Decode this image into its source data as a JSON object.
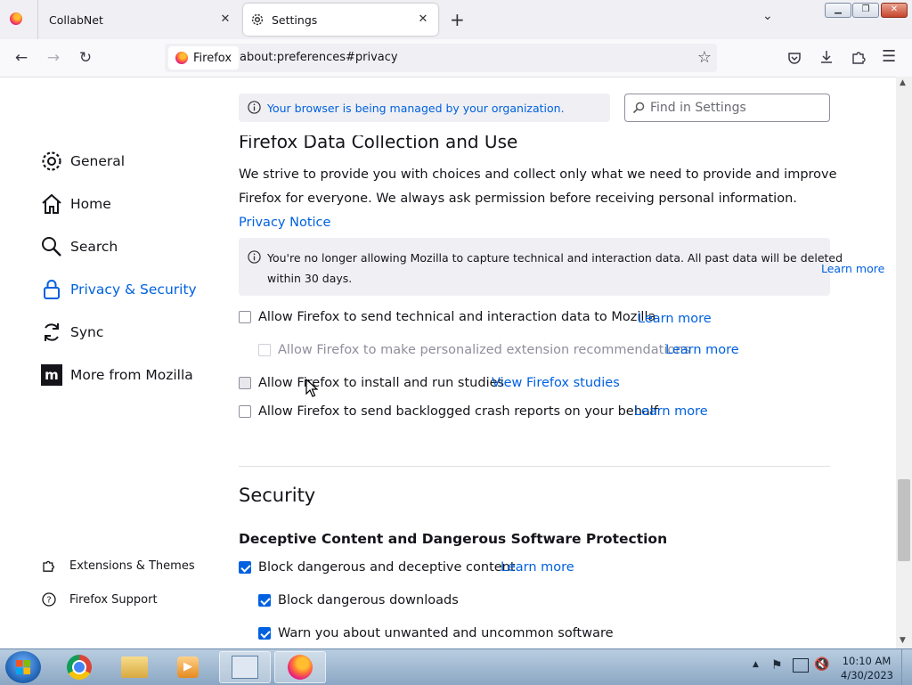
{
  "browser": {
    "tabs": [
      {
        "title": "CollabNet"
      },
      {
        "title": "Settings"
      }
    ],
    "identity_label": "Firefox",
    "url": "about:preferences#privacy"
  },
  "managed_notice": "Your browser is being managed by your organization.",
  "search": {
    "placeholder": "Find in Settings"
  },
  "sidebar": {
    "items": [
      {
        "label": "General",
        "icon": "gear-icon"
      },
      {
        "label": "Home",
        "icon": "home-icon"
      },
      {
        "label": "Search",
        "icon": "search-icon"
      },
      {
        "label": "Privacy & Security",
        "icon": "lock-icon",
        "selected": true
      },
      {
        "label": "Sync",
        "icon": "sync-icon"
      },
      {
        "label": "More from Mozilla",
        "icon": "mozilla-icon"
      }
    ],
    "footer": [
      {
        "label": "Extensions & Themes",
        "icon": "puzzle-icon"
      },
      {
        "label": "Firefox Support",
        "icon": "help-icon"
      }
    ]
  },
  "data_collection": {
    "heading_partial": "Firefox Data Collection and Use",
    "desc_line1": "We strive to provide you with choices and collect only what we need to provide and improve",
    "desc_line2": "Firefox for everyone. We always ask permission before receiving personal information.",
    "privacy_notice": "Privacy Notice",
    "info_line1": "You're no longer allowing Mozilla to capture technical and interaction data. All past data will be deleted",
    "info_line2": "within 30 days.",
    "info_learn_more": "Learn more",
    "options": [
      {
        "label": "Allow Firefox to send technical and interaction data to Mozilla",
        "link": "Learn more",
        "checked": false
      },
      {
        "label": "Allow Firefox to make personalized extension recommendations",
        "link": "Learn more",
        "checked": false,
        "disabled": true
      },
      {
        "label": "Allow Firefox to install and run studies",
        "link": "View Firefox studies",
        "checked": false
      },
      {
        "label": "Allow Firefox to send backlogged crash reports on your behalf",
        "link": "Learn more",
        "checked": false
      }
    ]
  },
  "security": {
    "heading": "Security",
    "subheading": "Deceptive Content and Dangerous Software Protection",
    "options": [
      {
        "label": "Block dangerous and deceptive content",
        "link": "Learn more",
        "checked": true
      },
      {
        "label": "Block dangerous downloads",
        "checked": true
      },
      {
        "label": "Warn you about unwanted and uncommon software",
        "checked": true
      }
    ]
  },
  "taskbar": {
    "time": "10:10 AM",
    "date": "4/30/2023"
  },
  "colors": {
    "accent": "#0061e0"
  }
}
